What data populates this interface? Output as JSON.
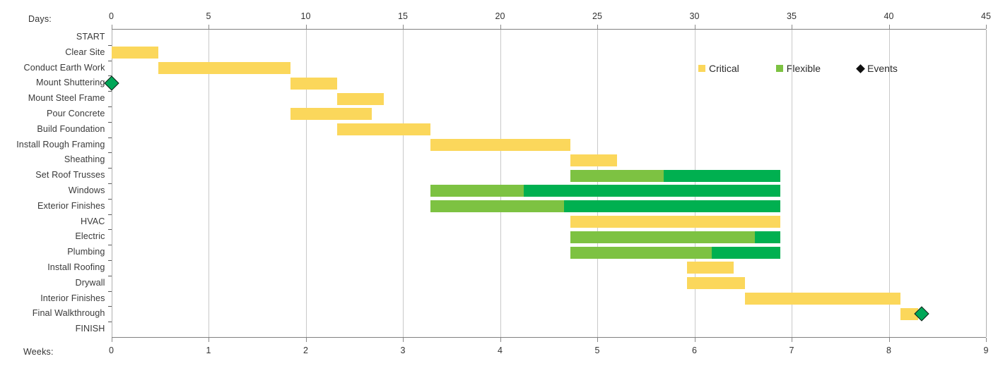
{
  "axes": {
    "top_caption": "Days:",
    "bottom_caption": "Weeks:",
    "days_ticks": [
      "0",
      "5",
      "10",
      "15",
      "20",
      "25",
      "30",
      "35",
      "40",
      "45"
    ],
    "weeks_ticks": [
      "0",
      "1",
      "2",
      "3",
      "4",
      "5",
      "6",
      "7",
      "8",
      "9"
    ]
  },
  "legend": {
    "items": [
      {
        "label": "Critical",
        "swatch": "critical",
        "color": "#FBD75B"
      },
      {
        "label": "Flexible",
        "swatch": "flexible",
        "color": "#7DC242"
      },
      {
        "label": "Events",
        "swatch": "events",
        "color": "#101010"
      }
    ]
  },
  "colors": {
    "critical": "#FBD75B",
    "flexible_light": "#7DC242",
    "flexible_dark": "#00B050",
    "event": "#00A758",
    "grid": "#C9C9C9",
    "axis": "#808080"
  },
  "chart_data": {
    "type": "bar",
    "chart_kind": "gantt",
    "title": "",
    "xlabel": "Days:",
    "xlabel_secondary": "Weeks:",
    "ylabel": "",
    "xlim": [
      0,
      45
    ],
    "xlim_weeks": [
      0,
      9
    ],
    "grid": true,
    "legend_position": "top-right",
    "categories": [
      "START",
      "Clear Site",
      "Conduct Earth Work",
      "Mount Shuttering",
      "Mount Steel Frame",
      "Pour Concrete",
      "Build Foundation",
      "Install Rough Framing",
      "Sheathing",
      "Set Roof Trusses",
      "Windows",
      "Exterior Finishes",
      "HVAC",
      "Electric",
      "Plumbing",
      "Install Roofing",
      "Drywall",
      "Interior Finishes",
      "Final Walkthrough",
      "FINISH"
    ],
    "series": [
      {
        "name": "Critical",
        "color": "#FBD75B"
      },
      {
        "name": "Flexible",
        "color": "#7DC242"
      },
      {
        "name": "Events",
        "color": "#101010"
      }
    ],
    "tasks": [
      {
        "task": "START",
        "segments": []
      },
      {
        "task": "Clear Site",
        "segments": [
          {
            "type": "critical",
            "start": 0.0,
            "end": 2.4
          }
        ]
      },
      {
        "task": "Conduct Earth Work",
        "segments": [
          {
            "type": "critical",
            "start": 2.4,
            "end": 9.2
          }
        ]
      },
      {
        "task": "Mount Shuttering",
        "segments": [
          {
            "type": "critical",
            "start": 9.2,
            "end": 11.6
          }
        ]
      },
      {
        "task": "Mount Steel Frame",
        "segments": [
          {
            "type": "critical",
            "start": 11.6,
            "end": 14.0
          }
        ]
      },
      {
        "task": "Pour Concrete",
        "segments": [
          {
            "type": "critical",
            "start": 9.2,
            "end": 13.4
          }
        ]
      },
      {
        "task": "Build Foundation",
        "segments": [
          {
            "type": "critical",
            "start": 11.6,
            "end": 16.4
          }
        ]
      },
      {
        "task": "Install Rough Framing",
        "segments": [
          {
            "type": "critical",
            "start": 16.4,
            "end": 23.6
          }
        ]
      },
      {
        "task": "Sheathing",
        "segments": [
          {
            "type": "critical",
            "start": 23.6,
            "end": 26.0
          }
        ]
      },
      {
        "task": "Set Roof Trusses",
        "segments": [
          {
            "type": "flexible_light",
            "start": 23.6,
            "end": 28.4
          },
          {
            "type": "flexible_dark",
            "start": 28.4,
            "end": 34.4
          }
        ]
      },
      {
        "task": "Windows",
        "segments": [
          {
            "type": "flexible_light",
            "start": 16.4,
            "end": 21.2
          },
          {
            "type": "flexible_dark",
            "start": 21.2,
            "end": 34.4
          }
        ]
      },
      {
        "task": "Exterior Finishes",
        "segments": [
          {
            "type": "flexible_light",
            "start": 16.4,
            "end": 23.3
          },
          {
            "type": "flexible_dark",
            "start": 23.3,
            "end": 34.4
          }
        ]
      },
      {
        "task": "HVAC",
        "segments": [
          {
            "type": "critical",
            "start": 23.6,
            "end": 34.4
          }
        ]
      },
      {
        "task": "Electric",
        "segments": [
          {
            "type": "flexible_light",
            "start": 23.6,
            "end": 33.1
          },
          {
            "type": "flexible_dark",
            "start": 33.1,
            "end": 34.4
          }
        ]
      },
      {
        "task": "Plumbing",
        "segments": [
          {
            "type": "flexible_light",
            "start": 23.6,
            "end": 30.9
          },
          {
            "type": "flexible_dark",
            "start": 30.9,
            "end": 34.4
          }
        ]
      },
      {
        "task": "Install Roofing",
        "segments": [
          {
            "type": "critical",
            "start": 29.6,
            "end": 32.0
          }
        ]
      },
      {
        "task": "Drywall",
        "segments": [
          {
            "type": "critical",
            "start": 29.6,
            "end": 32.6
          }
        ]
      },
      {
        "task": "Interior Finishes",
        "segments": [
          {
            "type": "critical",
            "start": 32.6,
            "end": 40.6
          }
        ]
      },
      {
        "task": "Final Walkthrough",
        "segments": [
          {
            "type": "critical",
            "start": 40.6,
            "end": 41.5
          }
        ]
      },
      {
        "task": "FINISH",
        "segments": []
      }
    ],
    "events": [
      {
        "label": "Mount Shuttering",
        "task": "Mount Shuttering",
        "day": 0.0,
        "row": 3
      },
      {
        "label": "Final Walkthrough",
        "task": "Final Walkthrough",
        "day": 41.7,
        "row": 18
      }
    ]
  }
}
